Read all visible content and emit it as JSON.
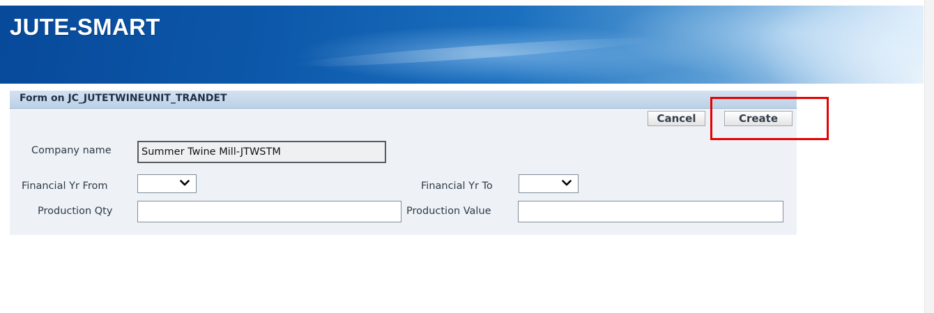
{
  "header": {
    "app_title": "JUTE-SMART"
  },
  "form": {
    "region_title": "Form on JC_JUTETWINEUNIT_TRANDET",
    "buttons": {
      "cancel": "Cancel",
      "create": "Create"
    },
    "fields": {
      "company_name": {
        "label": "Company name",
        "value": "Summer Twine Mill-JTWSTM"
      },
      "financial_yr_from": {
        "label": "Financial Yr From",
        "value": ""
      },
      "financial_yr_to": {
        "label": "Financial Yr To",
        "value": ""
      },
      "production_qty": {
        "label": "Production Qty",
        "value": ""
      },
      "production_value": {
        "label": "Production Value",
        "value": ""
      }
    }
  },
  "colors": {
    "banner_dark": "#07499a",
    "banner_light": "#e8f2fb",
    "region_header": "#c8d9eb",
    "region_body": "#eef2f7",
    "annotation": "#e60000"
  },
  "icons": {
    "select_arrow": "chevron-down-icon"
  }
}
